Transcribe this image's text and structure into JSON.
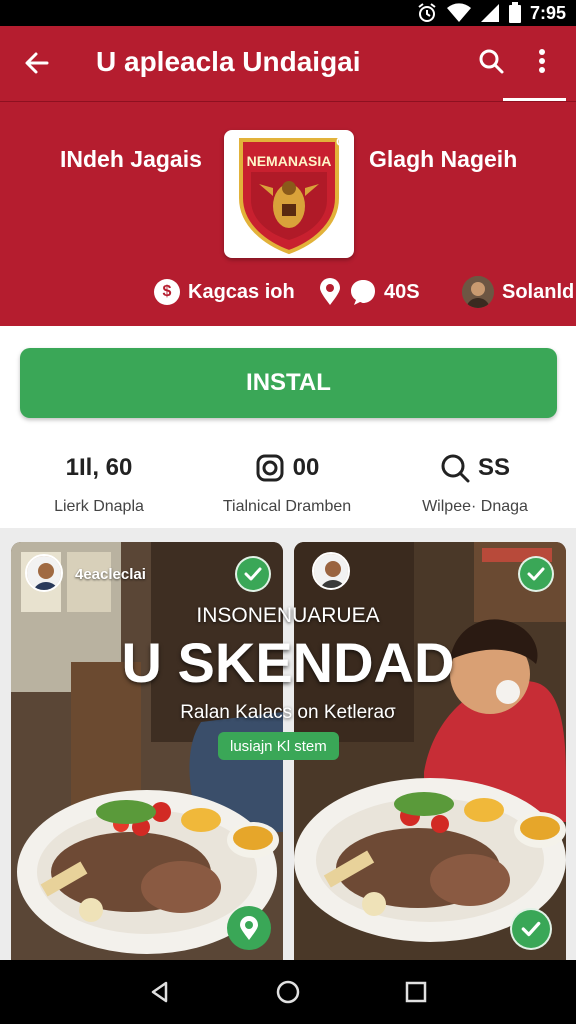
{
  "status_bar": {
    "time": "7:95"
  },
  "app_bar": {
    "title": "U apleacla Undaigai"
  },
  "header": {
    "left_text": "INdeh Jagais",
    "right_text": "Glagh Nageih",
    "logo_text": "NEMANASIA",
    "logo_corner": "C",
    "meta": {
      "currency_label": "Kagcas ioh",
      "comments_count": "40S",
      "developer_name": "Solanld"
    }
  },
  "install_label": "INSTAL",
  "stats": [
    {
      "value": "1Il, 60",
      "label": "Lierk Dnapla"
    },
    {
      "value": "00",
      "label": "Tialnical Dramben"
    },
    {
      "value": "SS",
      "label": "Wilpee· Dnaga"
    }
  ],
  "gallery": {
    "card1_user": "4eacleclai",
    "overlay_heading": "INSONENUARUEA",
    "overlay_headline": "U SKENDAD",
    "overlay_caption": "Ralan Kalacs on Ketleraσ",
    "overlay_tag": "lusiajn Kl stem"
  },
  "colors": {
    "brand_red": "#b51d2f",
    "accent_green": "#3aa757"
  },
  "icons": [
    "back-arrow-icon",
    "search-icon",
    "more-vert-icon",
    "dollar-icon",
    "location-pin-icon",
    "comment-icon",
    "camera-icon",
    "magnify-icon",
    "check-icon",
    "map-pin-icon"
  ]
}
